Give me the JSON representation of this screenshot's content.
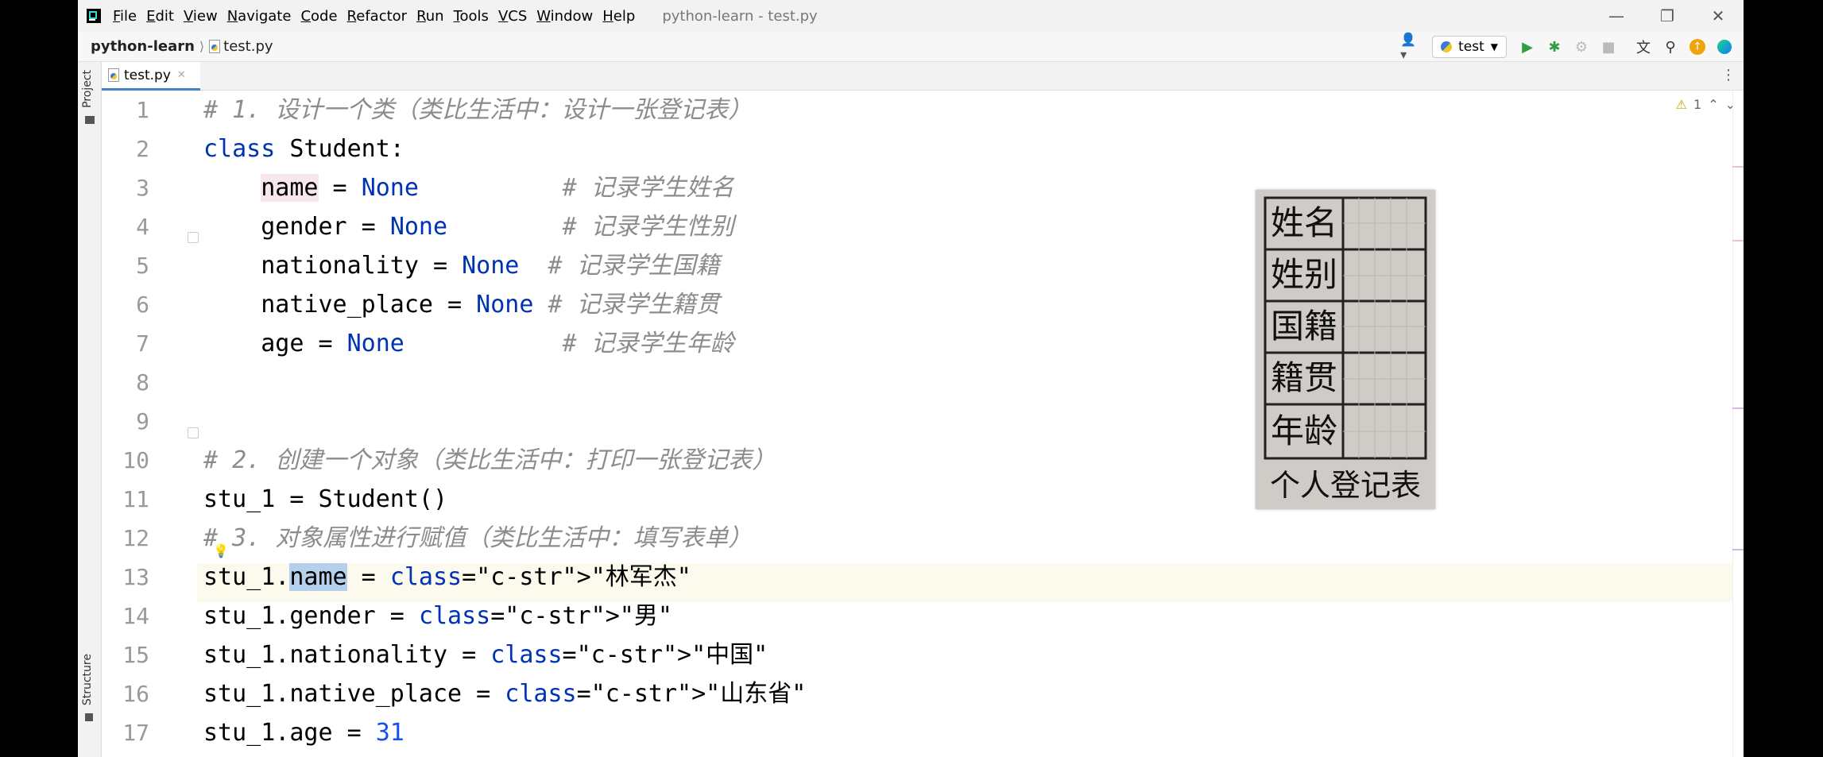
{
  "app": {
    "window_title": "python-learn - test.py",
    "menu": [
      "File",
      "Edit",
      "View",
      "Navigate",
      "Code",
      "Refactor",
      "Run",
      "Tools",
      "VCS",
      "Window",
      "Help"
    ]
  },
  "breadcrumb": {
    "project": "python-learn",
    "file": "test.py"
  },
  "toolbar": {
    "run_config": "test"
  },
  "sidebar": {
    "project_label": "Project",
    "structure_label": "Structure"
  },
  "tabs": [
    {
      "label": "test.py",
      "active": true
    }
  ],
  "inspection": {
    "warning_count": "1"
  },
  "editor": {
    "current_line": 13,
    "lines": [
      {
        "n": "1",
        "text": "# 1. 设计一个类（类比生活中：设计一张登记表）"
      },
      {
        "n": "2",
        "text": "class Student:"
      },
      {
        "n": "3",
        "text": "    name = None          # 记录学生姓名"
      },
      {
        "n": "4",
        "text": "    gender = None        # 记录学生性别"
      },
      {
        "n": "5",
        "text": "    nationality = None  # 记录学生国籍"
      },
      {
        "n": "6",
        "text": "    native_place = None # 记录学生籍贯"
      },
      {
        "n": "7",
        "text": "    age = None           # 记录学生年龄"
      },
      {
        "n": "8",
        "text": ""
      },
      {
        "n": "9",
        "text": ""
      },
      {
        "n": "10",
        "text": "# 2. 创建一个对象（类比生活中：打印一张登记表）"
      },
      {
        "n": "11",
        "text": "stu_1 = Student()"
      },
      {
        "n": "12",
        "text": "# 3. 对象属性进行赋值（类比生活中：填写表单）"
      },
      {
        "n": "13",
        "text": "stu_1.name = \"林军杰\""
      },
      {
        "n": "14",
        "text": "stu_1.gender = \"男\""
      },
      {
        "n": "15",
        "text": "stu_1.nationality = \"中国\""
      },
      {
        "n": "16",
        "text": "stu_1.native_place = \"山东省\""
      },
      {
        "n": "17",
        "text": "stu_1.age = 31"
      }
    ]
  },
  "paper_form": {
    "rows": [
      "姓名",
      "姓别",
      "国籍",
      "籍贯",
      "年龄"
    ],
    "caption": "个人登记表"
  },
  "colors": {
    "comment": "#8c8c8c",
    "keyword": "#0033b3",
    "string": "#067d17",
    "number": "#1750eb"
  }
}
